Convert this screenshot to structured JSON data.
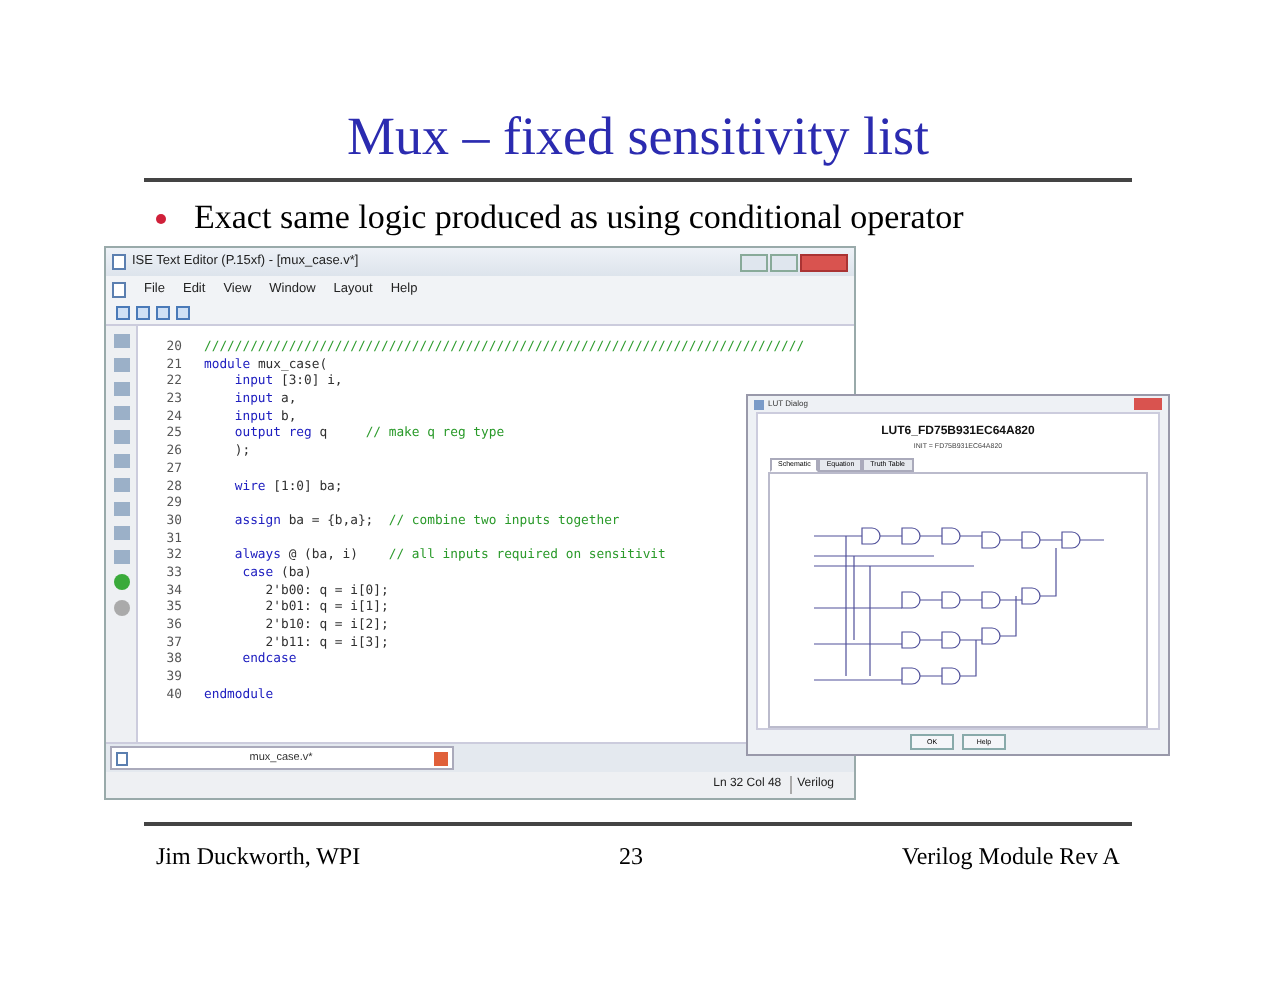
{
  "slide": {
    "title": "Mux – fixed sensitivity list",
    "bullets": [
      "Exact same logic produced as using conditional operator"
    ]
  },
  "editor": {
    "title": "ISE Text Editor (P.15xf) - [mux_case.v*]",
    "menu": [
      "File",
      "Edit",
      "View",
      "Window",
      "Layout",
      "Help"
    ],
    "lines": [
      {
        "num": "20",
        "segments": [
          {
            "kind": "comment",
            "text": "//////////////////////////////////////////////////////////////////////////////"
          }
        ]
      },
      {
        "num": "21",
        "segments": [
          {
            "kind": "keyword",
            "text": "module"
          },
          {
            "kind": "plain",
            "text": " mux_case("
          }
        ]
      },
      {
        "num": "22",
        "segments": [
          {
            "kind": "keyword",
            "text": "    input"
          },
          {
            "kind": "plain",
            "text": " [3:0] i,"
          }
        ]
      },
      {
        "num": "23",
        "segments": [
          {
            "kind": "keyword",
            "text": "    input"
          },
          {
            "kind": "plain",
            "text": " a,"
          }
        ]
      },
      {
        "num": "24",
        "segments": [
          {
            "kind": "keyword",
            "text": "    input"
          },
          {
            "kind": "plain",
            "text": " b,"
          }
        ]
      },
      {
        "num": "25",
        "segments": [
          {
            "kind": "keyword",
            "text": "    output reg"
          },
          {
            "kind": "plain",
            "text": " q     "
          },
          {
            "kind": "comment",
            "text": "// make q reg type"
          }
        ]
      },
      {
        "num": "26",
        "segments": [
          {
            "kind": "plain",
            "text": "    );"
          }
        ]
      },
      {
        "num": "27"
      },
      {
        "num": "28",
        "segments": [
          {
            "kind": "keyword",
            "text": "    wire"
          },
          {
            "kind": "plain",
            "text": " [1:0] ba;"
          }
        ]
      },
      {
        "num": "29"
      },
      {
        "num": "30",
        "segments": [
          {
            "kind": "keyword",
            "text": "    assign"
          },
          {
            "kind": "plain",
            "text": " ba = {b,a};  "
          },
          {
            "kind": "comment",
            "text": "// combine two inputs together"
          }
        ]
      },
      {
        "num": "31"
      },
      {
        "num": "32",
        "segments": [
          {
            "kind": "keyword",
            "text": "    always"
          },
          {
            "kind": "plain",
            "text": " @ (ba, i)    "
          },
          {
            "kind": "comment",
            "text": "// all inputs required on sensitivit"
          }
        ]
      },
      {
        "num": "33",
        "segments": [
          {
            "kind": "keyword",
            "text": "     case"
          },
          {
            "kind": "plain",
            "text": " (ba)"
          }
        ]
      },
      {
        "num": "34",
        "segments": [
          {
            "kind": "plain",
            "text": "        2'b00: q = i[0];"
          }
        ]
      },
      {
        "num": "35",
        "segments": [
          {
            "kind": "plain",
            "text": "        2'b01: q = i[1];"
          }
        ]
      },
      {
        "num": "36",
        "segments": [
          {
            "kind": "plain",
            "text": "        2'b10: q = i[2];"
          }
        ]
      },
      {
        "num": "37",
        "segments": [
          {
            "kind": "plain",
            "text": "        2'b11: q = i[3];"
          }
        ]
      },
      {
        "num": "38",
        "segments": [
          {
            "kind": "keyword",
            "text": "     endcase"
          }
        ]
      },
      {
        "num": "39"
      },
      {
        "num": "40",
        "segments": [
          {
            "kind": "keyword",
            "text": "endmodule"
          }
        ]
      }
    ],
    "file_tab": "mux_case.v*",
    "status": {
      "position": "Ln 32 Col 48",
      "language": "Verilog"
    }
  },
  "lut_dialog": {
    "title": "LUT Dialog",
    "heading": "LUT6_FD75B931EC64A820",
    "subheading": "INIT = FD75B931EC64A820",
    "tabs": [
      {
        "label": "Schematic",
        "selected": true
      },
      {
        "label": "Equation",
        "selected": false
      },
      {
        "label": "Truth Table",
        "selected": false
      }
    ],
    "buttons": [
      "OK",
      "Help"
    ]
  },
  "footer": {
    "left": "Jim Duckworth, WPI",
    "center": "23",
    "right": "Verilog Module Rev A"
  }
}
